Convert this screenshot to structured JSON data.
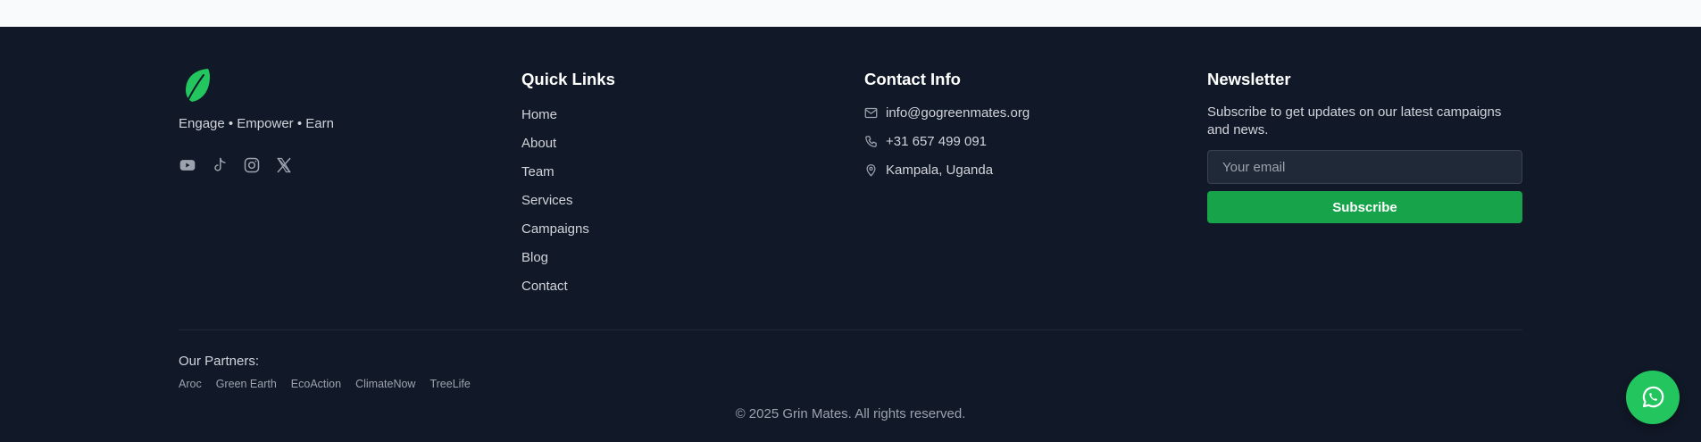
{
  "brand": {
    "tagline": "Engage • Empower • Earn",
    "logo_icon": "leaf-icon",
    "accent_color": "#16a34a"
  },
  "socials": [
    {
      "name": "youtube-icon"
    },
    {
      "name": "tiktok-icon"
    },
    {
      "name": "instagram-icon"
    },
    {
      "name": "x-icon"
    }
  ],
  "quick_links": {
    "heading": "Quick Links",
    "items": [
      "Home",
      "About",
      "Team",
      "Services",
      "Campaigns",
      "Blog",
      "Contact"
    ]
  },
  "contact": {
    "heading": "Contact Info",
    "email": "info@gogreenmates.org",
    "phone": "+31 657 499 091",
    "location": "Kampala, Uganda"
  },
  "newsletter": {
    "heading": "Newsletter",
    "description": "Subscribe to get updates on our latest campaigns and news.",
    "email_placeholder": "Your email",
    "subscribe_label": "Subscribe"
  },
  "partners": {
    "label": "Our Partners:",
    "items": [
      "Aroc",
      "Green Earth",
      "EcoAction",
      "ClimateNow",
      "TreeLife"
    ]
  },
  "copyright": "© 2025 Grin Mates. All rights reserved.",
  "whatsapp": {
    "icon": "whatsapp-icon",
    "color": "#22c55e"
  }
}
